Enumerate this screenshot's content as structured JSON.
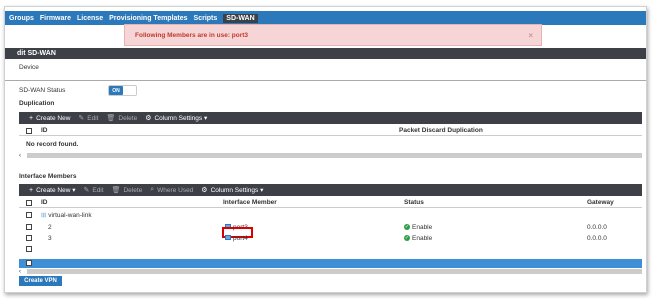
{
  "nav": {
    "tabs": [
      {
        "label": "Groups"
      },
      {
        "label": "Firmware"
      },
      {
        "label": "License"
      },
      {
        "label": "Provisioning Templates"
      },
      {
        "label": "Scripts"
      },
      {
        "label": "SD-WAN"
      }
    ],
    "active_tab": "SD-WAN"
  },
  "alert": {
    "message": "Following Members are in use: port3",
    "close": "×"
  },
  "edit_title": "dit SD-WAN",
  "device_label": "Device",
  "sdwan_status": {
    "label": "SD-WAN Status",
    "toggle": "ON"
  },
  "duplication": {
    "title": "Duplication",
    "toolbar": {
      "create_new": "Create New",
      "edit": "Edit",
      "delete": "Delete",
      "column_settings": "Column Settings ▾"
    },
    "columns": {
      "id": "ID",
      "packet_discard": "Packet Discard Duplication"
    },
    "empty": "No record found."
  },
  "members": {
    "title": "Interface Members",
    "toolbar": {
      "create_new": "Create New ▾",
      "edit": "Edit",
      "delete": "Delete",
      "where_used": "Where Used",
      "column_settings": "Column Settings ▾"
    },
    "columns": {
      "id": "ID",
      "interface": "Interface Member",
      "status": "Status",
      "gateway": "Gateway"
    },
    "group": "virtual-wan-link",
    "rows": [
      {
        "id": "2",
        "interface": "port3",
        "status": "Enable",
        "gateway": "0.0.0.0"
      },
      {
        "id": "3",
        "interface": "port4",
        "status": "Enable",
        "gateway": "0.0.0.0"
      }
    ]
  },
  "create_vpn": "Create VPN",
  "scroll_arrow": "‹",
  "colors": {
    "primary": "#2b78ba",
    "toolbar": "#3d4147",
    "alert_bg": "#f5d5d5",
    "alert_text": "#c0392b",
    "enable": "#2e9e44",
    "highlight": "#dd0000"
  }
}
